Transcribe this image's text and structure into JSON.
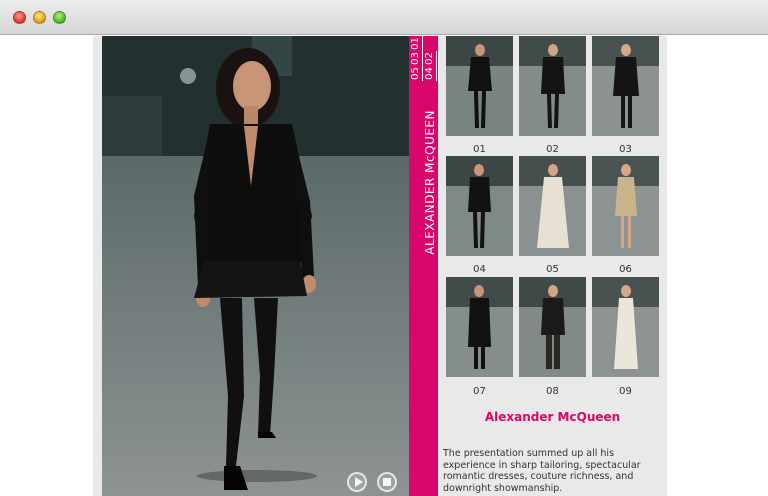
{
  "window": {
    "controls": [
      "close",
      "minimize",
      "zoom"
    ]
  },
  "main": {
    "designer_vertical": "ALEXANDER McQUEEN",
    "pages": [
      "01",
      "02",
      "03",
      "04",
      "05"
    ],
    "player": {
      "play_icon": "play-icon",
      "stop_icon": "stop-icon"
    }
  },
  "gallery": {
    "thumbnails": [
      {
        "label": "01",
        "outfit": "#111111"
      },
      {
        "label": "02",
        "outfit": "#141414"
      },
      {
        "label": "03",
        "outfit": "#151515"
      },
      {
        "label": "04",
        "outfit": "#121212"
      },
      {
        "label": "05",
        "outfit": "#e8e0d2"
      },
      {
        "label": "06",
        "outfit": "#c9b48c"
      },
      {
        "label": "07",
        "outfit": "#111111"
      },
      {
        "label": "08",
        "outfit": "#1c1a18"
      },
      {
        "label": "09",
        "outfit": "#ece6da"
      }
    ],
    "designer_name": "Alexander McQueen",
    "description": "The presentation summed up all his experience in sharp tailoring, spectacular romantic dresses, couture richness, and downright showmanship."
  },
  "colors": {
    "accent": "#d9066b",
    "panel_bg": "#e9e9e9"
  }
}
